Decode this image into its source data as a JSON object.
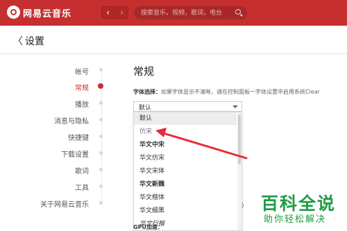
{
  "titlebar": {
    "app_name": "网易云音乐",
    "back": "‹",
    "forward": "›",
    "search_placeholder": "搜索音乐，视频，歌词，电台",
    "colors": {
      "brand": "#c62f2f"
    }
  },
  "header": {
    "back_icon": "chevron-left-icon",
    "title": "设置"
  },
  "sidebar": {
    "items": [
      {
        "label": "帐号",
        "active": false
      },
      {
        "label": "常规",
        "active": true
      },
      {
        "label": "播放",
        "active": false
      },
      {
        "label": "消息与隐私",
        "active": false
      },
      {
        "label": "快捷键",
        "active": false
      },
      {
        "label": "下载设置",
        "active": false
      },
      {
        "label": "歌词",
        "active": false
      },
      {
        "label": "工具",
        "active": false
      },
      {
        "label": "关于网易云音乐",
        "active": false
      }
    ]
  },
  "main": {
    "section_title": "常规",
    "font_label": "字体选择：",
    "font_hint": "如果字体显示不清晰，请在控制面板一字体设置中启用系统Clear",
    "font_select_value": "默认",
    "font_options": [
      {
        "label": "默认",
        "selected": true
      },
      {
        "label": "仿宋",
        "selected": false
      },
      {
        "label": "华文中宋",
        "selected": false
      },
      {
        "label": "华文仿宋",
        "selected": false
      },
      {
        "label": "华文宋体",
        "selected": false
      },
      {
        "label": "华文新魏",
        "selected": false
      },
      {
        "label": "华文楷体",
        "selected": false
      },
      {
        "label": "华文细黑",
        "selected": false
      },
      {
        "label": "华文行楷",
        "selected": false
      }
    ],
    "partial_paren": ")",
    "gpu_label": "GPU加速："
  },
  "watermark": {
    "main": "百科全说",
    "sub": "助你轻松解决"
  },
  "annotation_arrow_color": "#e8293a"
}
